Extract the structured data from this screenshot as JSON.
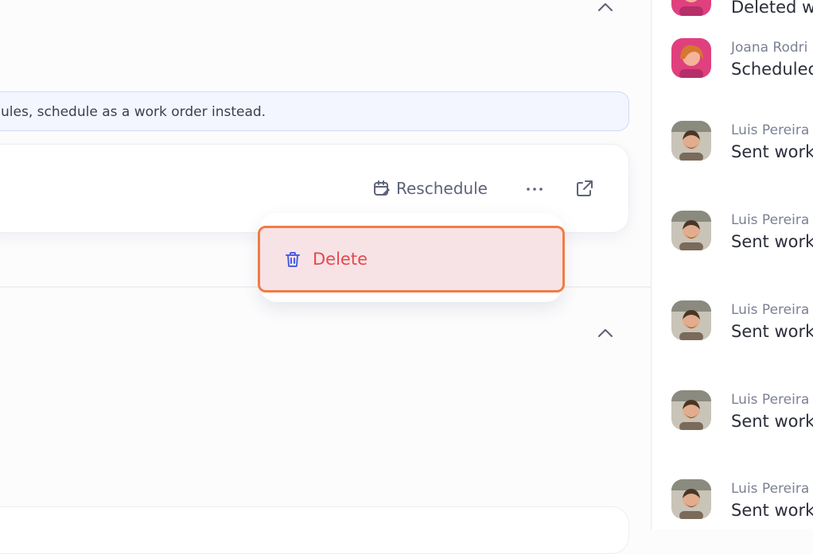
{
  "banner": {
    "text": "ules, schedule as a work order instead."
  },
  "card": {
    "reschedule_label": "Reschedule",
    "more_label": "···"
  },
  "menu": {
    "delete_label": "Delete"
  },
  "activity": [
    {
      "name": "",
      "message": "Deleted w",
      "avatar": "joana"
    },
    {
      "name": "Joana Rodri",
      "message": "Schedulec",
      "avatar": "joana"
    },
    {
      "name": "Luis Pereira",
      "message": "Sent work",
      "avatar": "luis"
    },
    {
      "name": "Luis Pereira",
      "message": "Sent work",
      "avatar": "luis"
    },
    {
      "name": "Luis Pereira",
      "message": "Sent work",
      "avatar": "luis"
    },
    {
      "name": "Luis Pereira",
      "message": "Sent work",
      "avatar": "luis"
    },
    {
      "name": "Luis Pereira",
      "message": "Sent work",
      "avatar": "luis"
    }
  ],
  "colors": {
    "accent": "#4a5de8",
    "danger": "#e5484d",
    "focus_ring": "#f07c45",
    "danger_bg": "#f7e3e6"
  }
}
